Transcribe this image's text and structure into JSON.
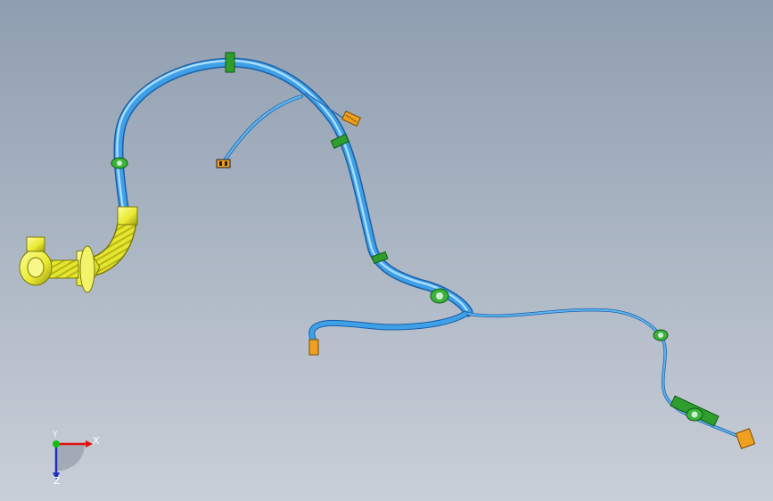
{
  "colors": {
    "background_top": "#8f9eb0",
    "background_bottom": "#c9cfd8",
    "cable_blue": "#3ea0e6",
    "clip_green": "#2f9e2f",
    "connector_orange": "#f0a020",
    "grommet_yellow": "#e8e830"
  },
  "triad": {
    "x_label": "X",
    "y_label": "Y",
    "z_label": "Z"
  }
}
